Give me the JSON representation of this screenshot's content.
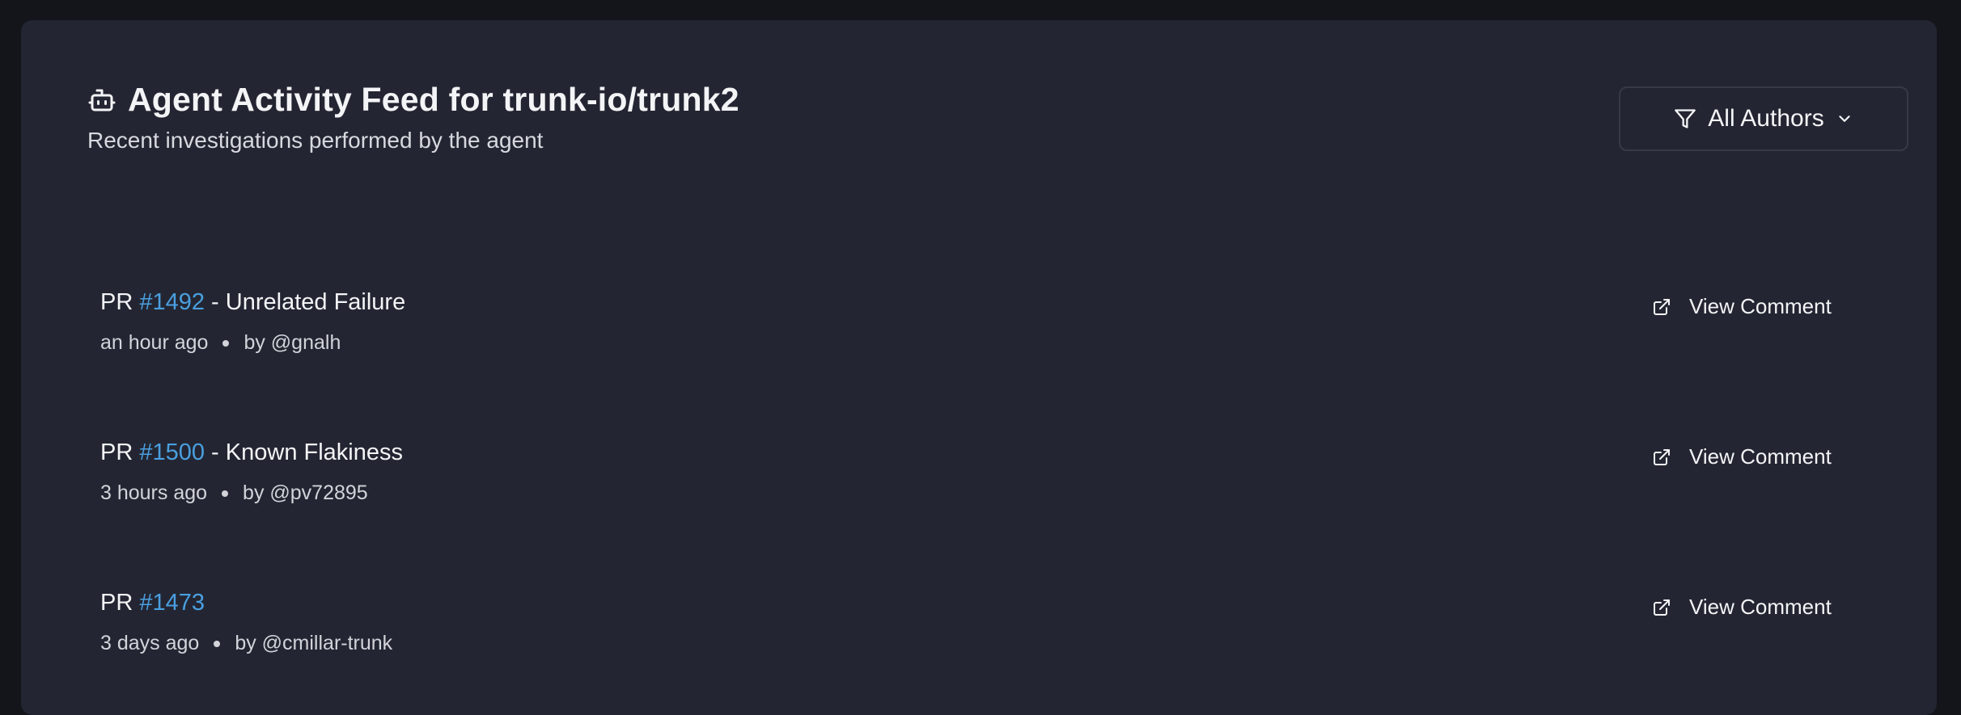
{
  "header": {
    "title": "Agent Activity Feed for trunk-io/trunk2",
    "subtitle": "Recent investigations performed by the agent",
    "icon": "robot-icon"
  },
  "filter": {
    "label": "All Authors",
    "icon": "filter-icon",
    "chevron": "chevron-down-icon"
  },
  "feed": {
    "items": [
      {
        "prefix": "PR ",
        "pr_number": "#1492",
        "suffix": " - Unrelated Failure",
        "time": "an hour ago",
        "author": "by @gnalh",
        "action_label": "View Comment"
      },
      {
        "prefix": "PR ",
        "pr_number": "#1500",
        "suffix": " - Known Flakiness",
        "time": "3 hours ago",
        "author": "by @pv72895",
        "action_label": "View Comment"
      },
      {
        "prefix": "PR ",
        "pr_number": "#1473",
        "suffix": "",
        "time": "3 days ago",
        "author": "by @cmillar-trunk",
        "action_label": "View Comment"
      }
    ]
  },
  "colors": {
    "background": "#13151b",
    "card": "#232632",
    "link": "#4a9fe0",
    "text": "#f3f4f6"
  }
}
